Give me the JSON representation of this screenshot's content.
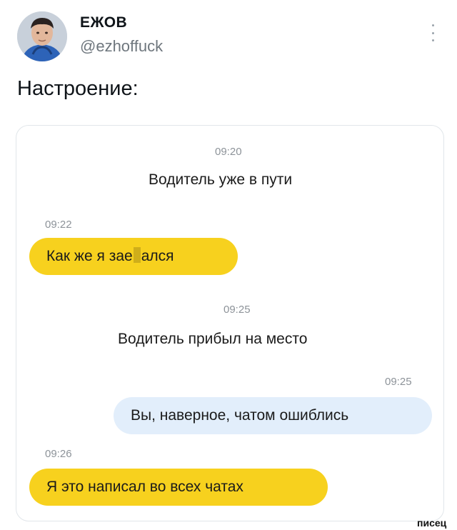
{
  "tweet": {
    "author_name": "ЕЖОВ",
    "author_handle": "@ezhoffuck",
    "text": "Настроение:"
  },
  "chat": {
    "messages": [
      {
        "kind": "system",
        "time": "09:20",
        "text": "Водитель уже в пути"
      },
      {
        "kind": "incoming",
        "time": "09:22",
        "text_before": "Как же я зае",
        "text_after": "ался",
        "censored": true
      },
      {
        "kind": "system",
        "time": "09:25",
        "text": "Водитель прибыл на место"
      },
      {
        "kind": "outgoing",
        "time": "09:25",
        "text": "Вы, наверное, чатом ошиблись"
      },
      {
        "kind": "incoming",
        "time": "09:26",
        "text": "Я это написал во всех чатах"
      }
    ]
  },
  "watermark": "писец",
  "colors": {
    "incoming_bubble": "#f7d11e",
    "outgoing_bubble": "#e2eefb",
    "timestamp": "#8d9399",
    "handle": "#6e767d"
  },
  "icons": {
    "more": "vertical-dots-icon",
    "avatar": "user-avatar"
  }
}
